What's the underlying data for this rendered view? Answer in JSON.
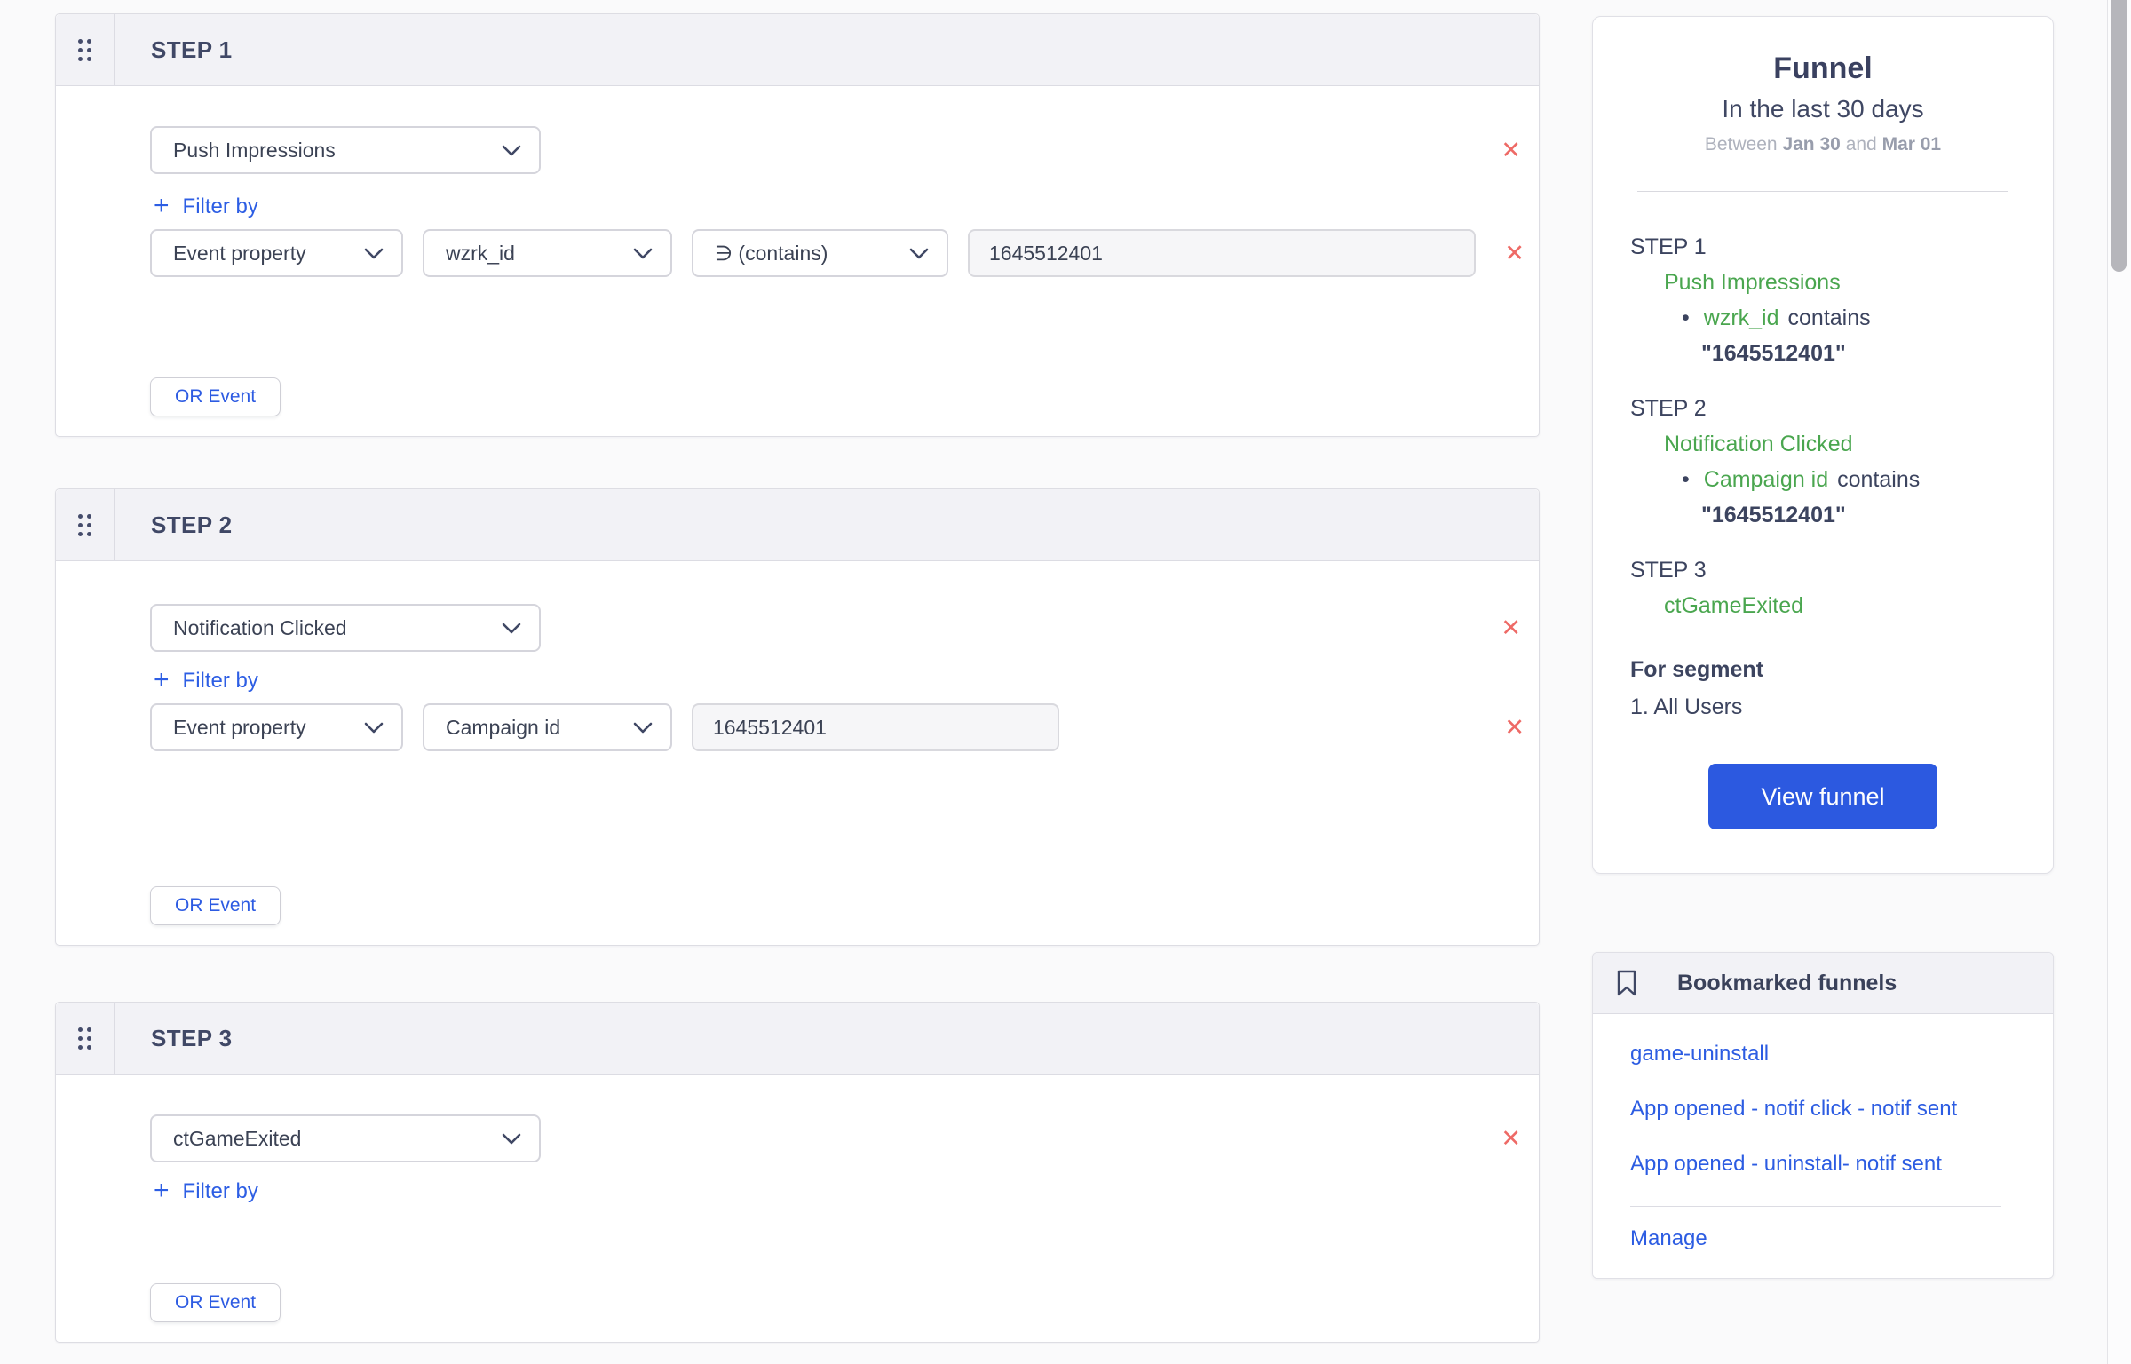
{
  "icons": {
    "remove": "✕",
    "plus": "+",
    "bullet": "•"
  },
  "steps": [
    {
      "title": "STEP 1",
      "event": "Push Impressions",
      "filter_by": "Filter by",
      "or_event": "OR Event",
      "filter": {
        "type": "Event property",
        "property": "wzrk_id",
        "operator": "∋  (contains)",
        "value": "1645512401"
      }
    },
    {
      "title": "STEP 2",
      "event": "Notification Clicked",
      "filter_by": "Filter by",
      "or_event": "OR Event",
      "filter": {
        "type": "Event property",
        "property": "Campaign id",
        "value": "1645512401"
      }
    },
    {
      "title": "STEP 3",
      "event": "ctGameExited",
      "filter_by": "Filter by",
      "or_event": "OR Event"
    }
  ],
  "funnel": {
    "title": "Funnel",
    "range": "In the last 30 days",
    "between": {
      "prefix": "Between",
      "start": "Jan 30",
      "conj": "and",
      "end": "Mar 01"
    },
    "steps": [
      {
        "label": "STEP 1",
        "event": "Push Impressions",
        "property": "wzrk_id",
        "verb": "contains",
        "value": "\"1645512401\""
      },
      {
        "label": "STEP 2",
        "event": "Notification Clicked",
        "property": "Campaign id",
        "verb": "contains",
        "value": "\"1645512401\""
      },
      {
        "label": "STEP 3",
        "event": "ctGameExited"
      }
    ],
    "for_segment": "For segment",
    "segment": "1. All Users",
    "view_funnel": "View funnel"
  },
  "bookmarks": {
    "title": "Bookmarked funnels",
    "items": [
      "game-uninstall",
      "App opened - notif click - notif sent",
      "App opened - uninstall- notif sent"
    ],
    "manage": "Manage"
  },
  "colors": {
    "accent_blue": "#2c59e0",
    "link_blue": "#2c5ce2",
    "event_green": "#4aa64f",
    "danger_red": "#ee6a66",
    "dark_text": "#3c445f"
  }
}
